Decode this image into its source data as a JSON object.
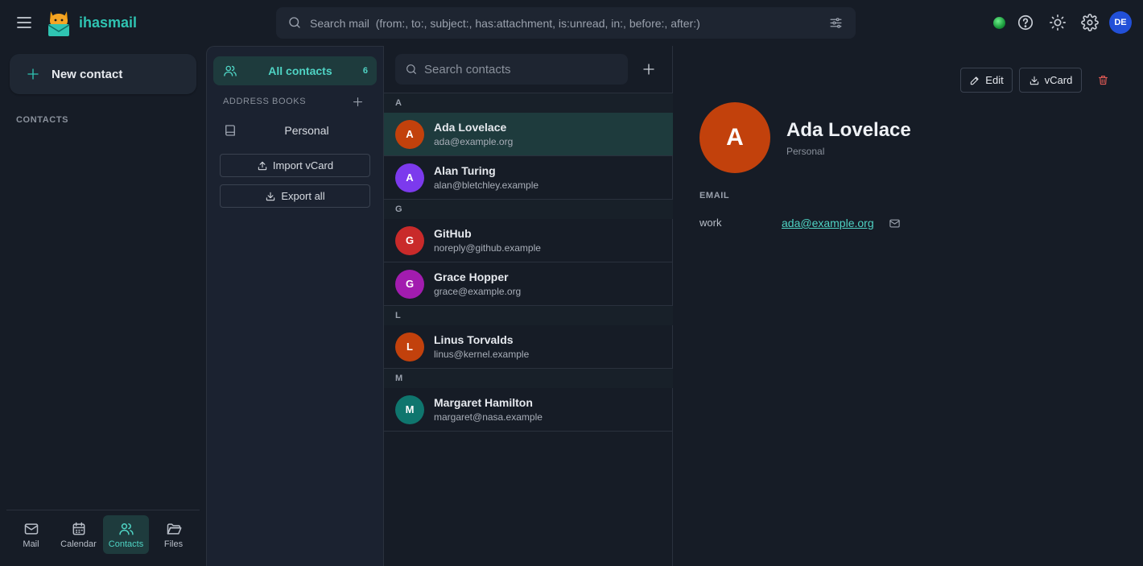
{
  "app": {
    "brand": "ihasmail"
  },
  "topbar": {
    "search_placeholder": "Search mail  (from:, to:, subject:, has:attachment, is:unread, in:, before:, after:)",
    "user_initials": "DE",
    "status_color": "#22c55e"
  },
  "leftnav": {
    "new_contact_label": "New contact",
    "section_label": "CONTACTS",
    "bottom_items": [
      {
        "label": "Mail",
        "icon": "mail-icon"
      },
      {
        "label": "Calendar",
        "icon": "calendar-icon"
      },
      {
        "label": "Contacts",
        "icon": "contacts-icon",
        "active": true
      },
      {
        "label": "Files",
        "icon": "folder-icon"
      }
    ]
  },
  "books": {
    "all_contacts_label": "All contacts",
    "all_contacts_count": "6",
    "address_books_title": "ADDRESS BOOKS",
    "items": [
      {
        "label": "Personal"
      }
    ],
    "import_label": "Import vCard",
    "export_label": "Export all"
  },
  "list": {
    "search_placeholder": "Search contacts",
    "groups": [
      {
        "letter": "A",
        "contacts": [
          {
            "name": "Ada Lovelace",
            "email": "ada@example.org",
            "initial": "A",
            "color": "#c2410c",
            "selected": true
          },
          {
            "name": "Alan Turing",
            "email": "alan@bletchley.example",
            "initial": "A",
            "color": "#7c3aed"
          }
        ]
      },
      {
        "letter": "G",
        "contacts": [
          {
            "name": "GitHub",
            "email": "noreply@github.example",
            "initial": "G",
            "color": "#c92a2a"
          },
          {
            "name": "Grace Hopper",
            "email": "grace@example.org",
            "initial": "G",
            "color": "#a21caf"
          }
        ]
      },
      {
        "letter": "L",
        "contacts": [
          {
            "name": "Linus Torvalds",
            "email": "linus@kernel.example",
            "initial": "L",
            "color": "#c2410c"
          }
        ]
      },
      {
        "letter": "M",
        "contacts": [
          {
            "name": "Margaret Hamilton",
            "email": "margaret@nasa.example",
            "initial": "M",
            "color": "#0f766e"
          }
        ]
      }
    ]
  },
  "detail": {
    "edit_label": "Edit",
    "vcard_label": "vCard",
    "avatar_initial": "A",
    "name": "Ada Lovelace",
    "book": "Personal",
    "email_section": "EMAIL",
    "email_type": "work",
    "email": "ada@example.org"
  },
  "colors": {
    "accent": "#2fc4b2",
    "danger": "#e05a55",
    "avatar_user": "#2250d8"
  }
}
